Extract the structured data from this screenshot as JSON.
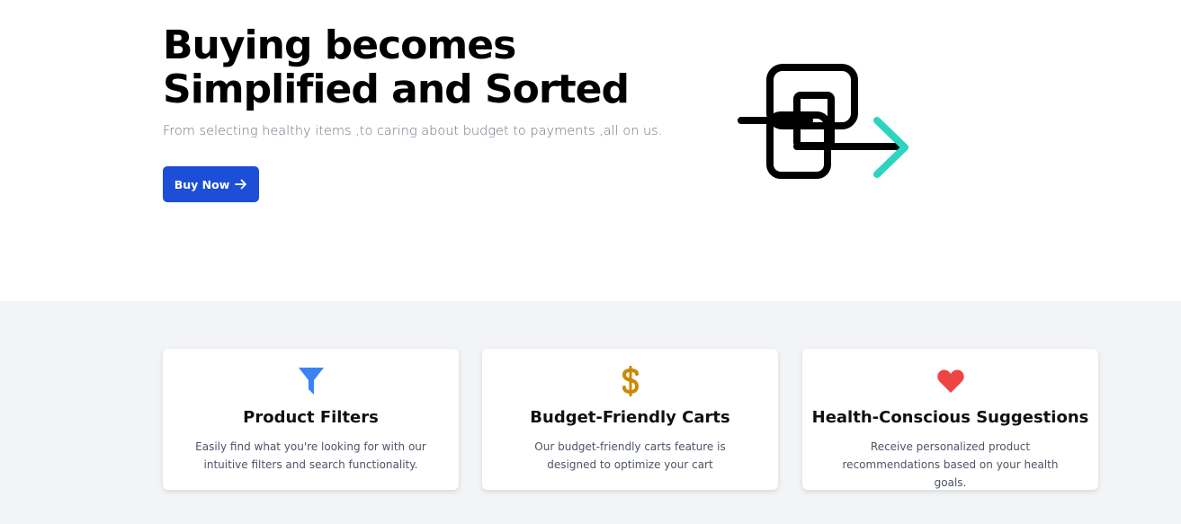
{
  "hero": {
    "title_line1": "Buying becomes",
    "title_line2": "Simplified and Sorted",
    "subtitle": "From selecting healthy items ,to caring about budget to payments ,all on us.",
    "cta_label": "Buy Now",
    "cta_icon": "arrow-right-icon",
    "logo_icon": "cart-arrow-logo-icon",
    "accent_color": "#2dd4bf",
    "button_color": "#1d4ed8"
  },
  "features": [
    {
      "icon": "filter-icon",
      "icon_color": "#3b82f6",
      "title": "Product Filters",
      "description": "Easily find what you're looking for with our intuitive filters and search functionality."
    },
    {
      "icon": "dollar-icon",
      "icon_color": "#ca8a04",
      "title": "Budget-Friendly Carts",
      "description": "Our budget-friendly carts feature is designed to optimize your cart"
    },
    {
      "icon": "heart-icon",
      "icon_color": "#ef4444",
      "title": "Health-Conscious Suggestions",
      "description": "Receive personalized product recommendations based on your health goals."
    }
  ]
}
